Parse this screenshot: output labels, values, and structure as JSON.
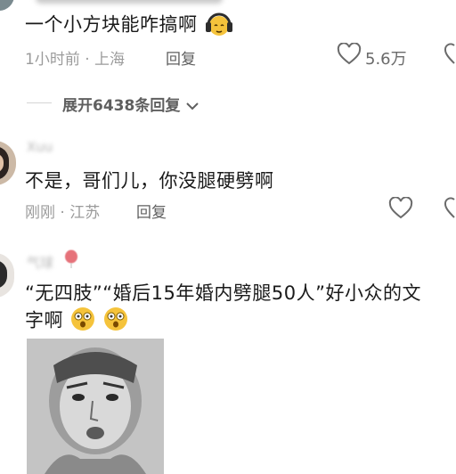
{
  "comments": [
    {
      "text": "一个小方块能咋搞啊",
      "time": "1小时前",
      "location": "上海",
      "reply_label": "回复",
      "likes": "5.6万",
      "expand_label": "展开6438条回复",
      "reply_count": "6438"
    },
    {
      "username": "Xuu",
      "text": "不是，哥们儿，你没腿硬劈啊",
      "time": "刚刚",
      "location": "江苏",
      "reply_label": "回复"
    },
    {
      "username": "气球",
      "text_line1": "“无四肢”“婚后15年婚内劈腿50人”好小众的文",
      "text_line2": "字啊"
    }
  ],
  "colors": {
    "text": "#1a1a1a",
    "meta": "#9b9b9b",
    "action": "#5f5f5f",
    "emoji": "#f5c33b"
  },
  "icons": [
    "headphones-emoji",
    "heart-icon",
    "chevron-down-icon",
    "shocked-emoji",
    "meme-sticker"
  ]
}
